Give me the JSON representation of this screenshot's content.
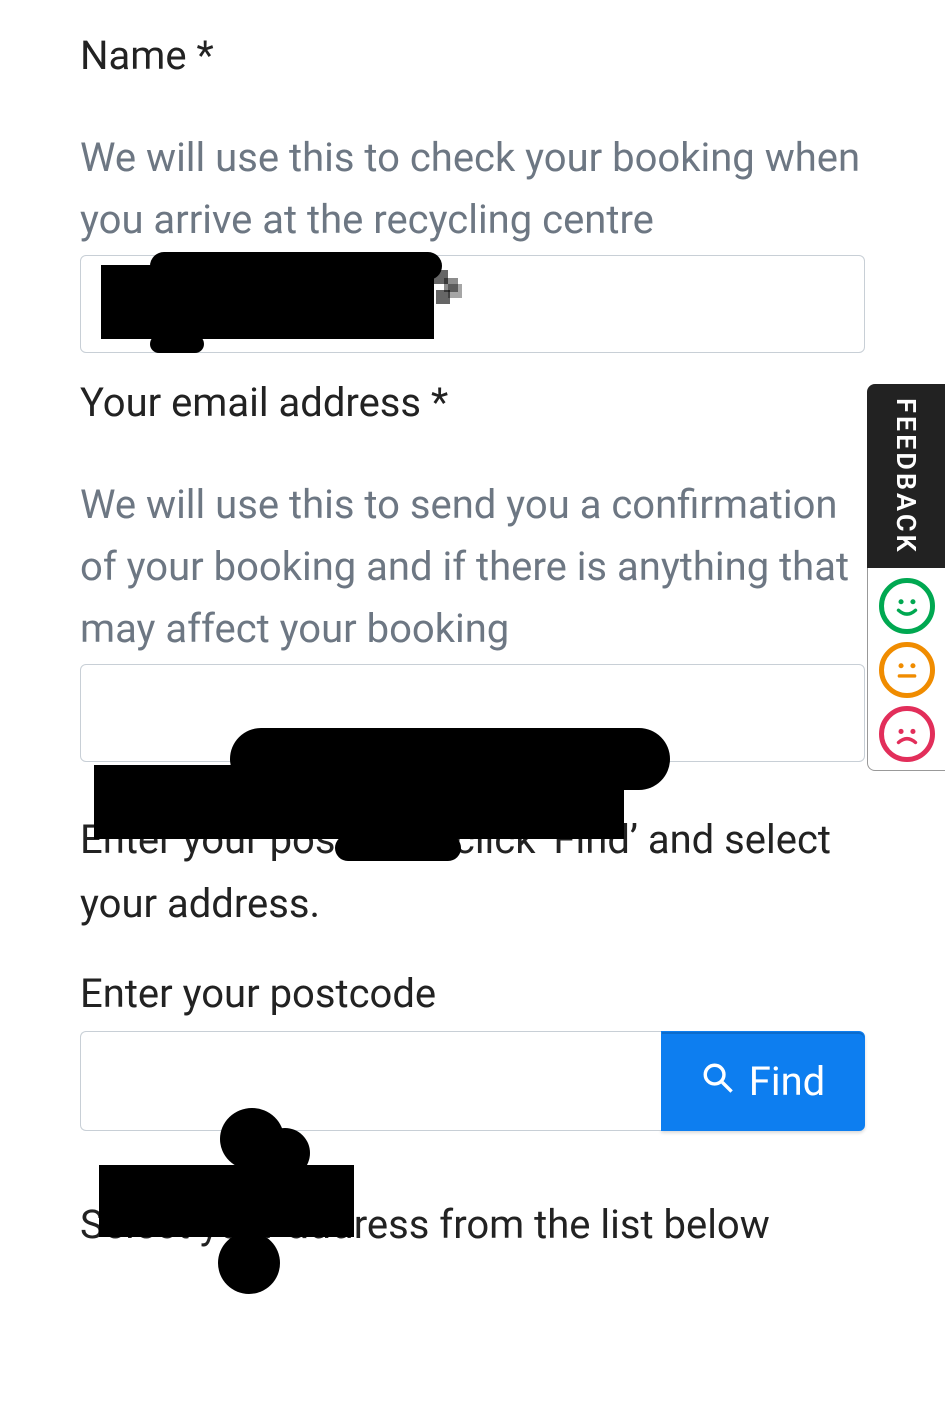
{
  "form": {
    "name_label": "Name *",
    "name_hint": "We will use this to check your booking when you arrive at the recycling centre",
    "email_label": "Your email address *",
    "email_hint": "We will use this to send you a confirmation of your booking and if there is anything that may affect your booking",
    "postcode_instructions": "Enter your postcode, click ‘Find’ and select your address.",
    "postcode_label": "Enter your postcode",
    "find_button": "Find",
    "select_address_label": "Select your address from the list below"
  },
  "feedback": {
    "label": "FEEDBACK"
  }
}
